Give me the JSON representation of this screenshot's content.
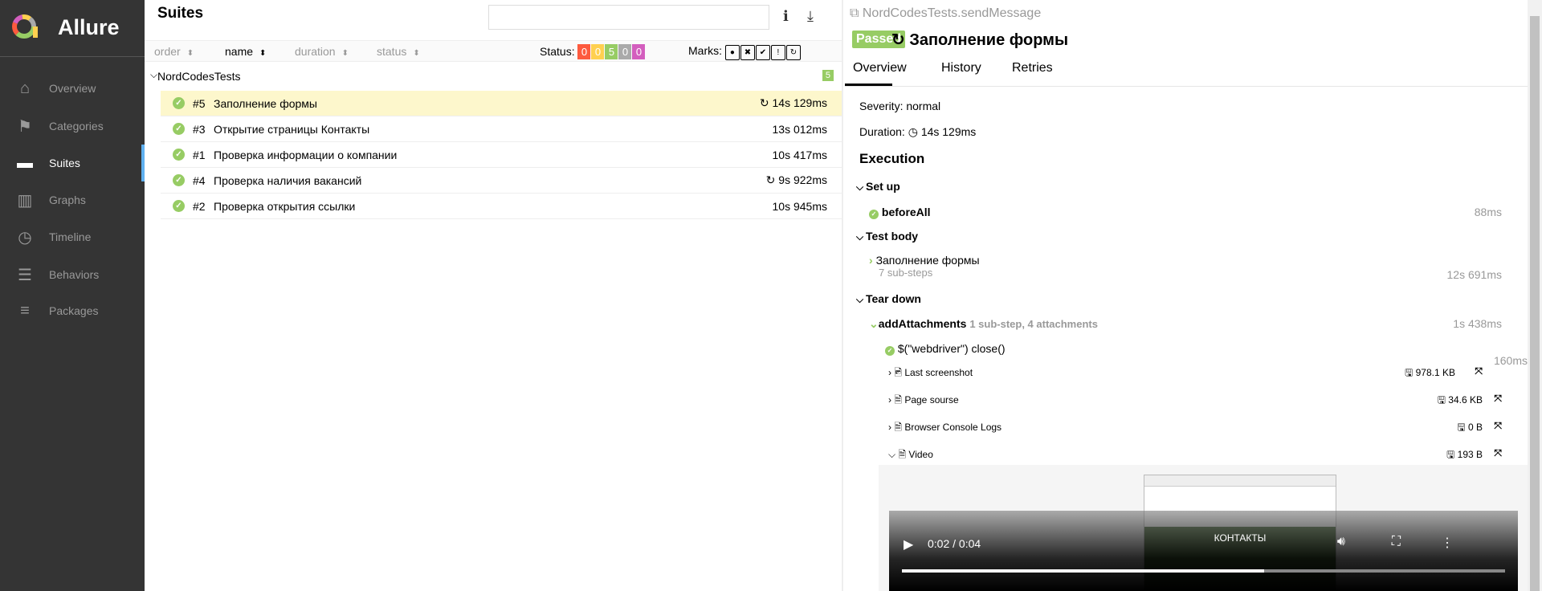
{
  "app": {
    "name": "Allure",
    "logo_colors": [
      "#97cc64",
      "#fd5a3e",
      "#d35ebe",
      "#ffd050",
      "#aaaaaa"
    ]
  },
  "sidebar": {
    "items": [
      {
        "label": "Overview",
        "icon": "home-icon",
        "active": false
      },
      {
        "label": "Categories",
        "icon": "flag-icon",
        "active": false
      },
      {
        "label": "Suites",
        "icon": "briefcase-icon",
        "active": true
      },
      {
        "label": "Graphs",
        "icon": "bar-chart-icon",
        "active": false
      },
      {
        "label": "Timeline",
        "icon": "clock-icon",
        "active": false
      },
      {
        "label": "Behaviors",
        "icon": "list-icon",
        "active": false
      },
      {
        "label": "Packages",
        "icon": "align-left-icon",
        "active": false
      }
    ]
  },
  "suites": {
    "title": "Suites",
    "search_value": "",
    "sort": {
      "order": "order",
      "name": "name",
      "duration": "duration",
      "status": "status"
    },
    "status_label": "Status:",
    "status_counts": [
      {
        "value": "0",
        "color": "#fd5a3e"
      },
      {
        "value": "0",
        "color": "#ffd050"
      },
      {
        "value": "5",
        "color": "#97cc64"
      },
      {
        "value": "0",
        "color": "#aaaaaa"
      },
      {
        "value": "0",
        "color": "#d35ebe"
      }
    ],
    "marks_label": "Marks:",
    "group": {
      "name": "NordCodesTests",
      "count": "5"
    },
    "rows": [
      {
        "num": "#5",
        "name": "Заполнение формы",
        "duration": "14s 129ms",
        "retry": true,
        "selected": true
      },
      {
        "num": "#3",
        "name": "Открытие страницы Контакты",
        "duration": "13s 012ms",
        "retry": false,
        "selected": false
      },
      {
        "num": "#1",
        "name": "Проверка информации о компании",
        "duration": "10s 417ms",
        "retry": false,
        "selected": false
      },
      {
        "num": "#4",
        "name": "Проверка наличия вакансий",
        "duration": "9s 922ms",
        "retry": true,
        "selected": false
      },
      {
        "num": "#2",
        "name": "Проверка открытия ссылки",
        "duration": "10s 945ms",
        "retry": false,
        "selected": false
      }
    ]
  },
  "test": {
    "full_name": "NordCodesTests.sendMessage",
    "status": "Passed",
    "status_color": "#97cc64",
    "title": "Заполнение формы",
    "tabs": [
      "Overview",
      "History",
      "Retries"
    ],
    "severity": "Severity: normal",
    "duration_label": "Duration:",
    "duration": "14s 129ms",
    "execution": "Execution",
    "setup": {
      "label": "Set up",
      "step": "beforeAll",
      "duration": "88ms"
    },
    "body": {
      "label": "Test body",
      "step": "Заполнение формы",
      "sub": "7 sub-steps",
      "duration": "12s 691ms"
    },
    "teardown": {
      "label": "Tear down",
      "step": "addAttachments",
      "info": "1 sub-step, 4 attachments",
      "duration": "1s 438ms",
      "substep": "$(\"webdriver\") close()",
      "substep_duration": "160ms",
      "attachments": [
        {
          "name": "Last screenshot",
          "size": "978.1 KB"
        },
        {
          "name": "Page sourse",
          "size": "34.6 KB"
        },
        {
          "name": "Browser Console Logs",
          "size": "0 B"
        },
        {
          "name": "Video",
          "size": "193 B"
        }
      ]
    },
    "video": {
      "time": "0:02 / 0:04",
      "progress": 0.6,
      "frame_text": "КОНТАКТЫ"
    }
  }
}
